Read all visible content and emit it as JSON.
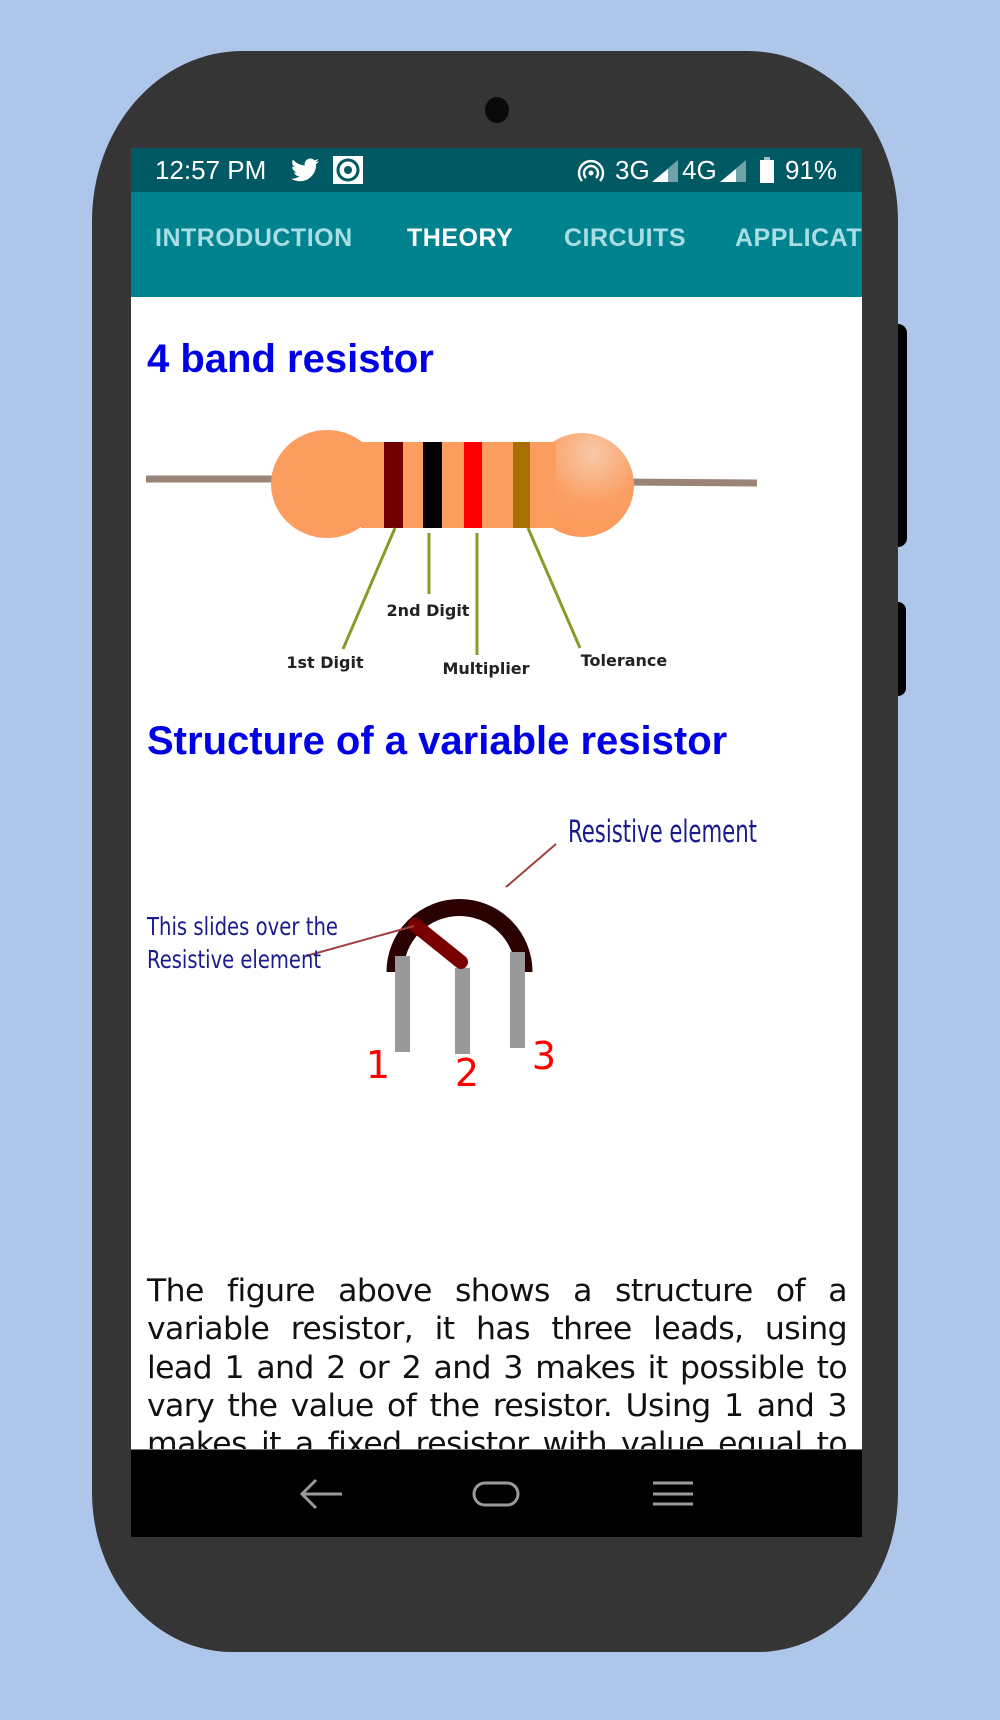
{
  "status_bar": {
    "time": "12:57 PM",
    "left_icons": [
      "twitter-icon",
      "record-icon"
    ],
    "right_icons": [
      "hotspot-icon"
    ],
    "network_1": "3G",
    "network_2": "4G",
    "battery_percent": "91%",
    "battery_level": 0.91
  },
  "tabs": [
    {
      "label": "INTRODUCTION",
      "active": false
    },
    {
      "label": "THEORY",
      "active": true
    },
    {
      "label": "CIRCUITS",
      "active": false
    },
    {
      "label": "APPLICATIONS",
      "visible_label": "APPLICAT",
      "active": false
    }
  ],
  "content": {
    "section1_title": "4 band resistor",
    "resistor_figure": {
      "band_colors": [
        "#720000",
        "#000000",
        "#FF0000",
        "#A87000"
      ],
      "labels": {
        "first": "1st Digit",
        "second": "2nd Digit",
        "multiplier": "Multiplier",
        "tolerance": "Tolerance"
      }
    },
    "section2_title": "Structure of a variable resistor",
    "variable_figure": {
      "resistive_label": "Resistive element",
      "wiper_label_line1": "This slides over the",
      "wiper_label_line2": "Resistive element",
      "pin_labels": [
        "1",
        "2",
        "3"
      ]
    },
    "paragraph": "The figure above shows a structure of a variable resistor, it has three leads, using lead 1 and 2 or 2 and 3 makes it possible to vary the value of the resistor. Using 1 and 3 makes it a fixed resistor with value equal to the maximum value of the potentiometer."
  },
  "nav_bar": {
    "buttons": [
      "back-icon",
      "home-icon",
      "recents-icon"
    ]
  },
  "colors": {
    "background": "#AFC6EB",
    "status_bar": "#005963",
    "tab_bar": "#00838F",
    "heading": "#0000E6"
  }
}
